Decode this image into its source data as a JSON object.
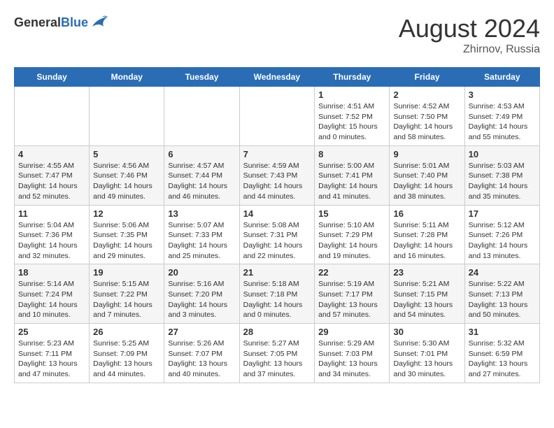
{
  "header": {
    "logo_general": "General",
    "logo_blue": "Blue",
    "month_year": "August 2024",
    "location": "Zhirnov, Russia"
  },
  "days_of_week": [
    "Sunday",
    "Monday",
    "Tuesday",
    "Wednesday",
    "Thursday",
    "Friday",
    "Saturday"
  ],
  "weeks": [
    [
      {
        "num": "",
        "info": ""
      },
      {
        "num": "",
        "info": ""
      },
      {
        "num": "",
        "info": ""
      },
      {
        "num": "",
        "info": ""
      },
      {
        "num": "1",
        "info": "Sunrise: 4:51 AM\nSunset: 7:52 PM\nDaylight: 15 hours\nand 0 minutes."
      },
      {
        "num": "2",
        "info": "Sunrise: 4:52 AM\nSunset: 7:50 PM\nDaylight: 14 hours\nand 58 minutes."
      },
      {
        "num": "3",
        "info": "Sunrise: 4:53 AM\nSunset: 7:49 PM\nDaylight: 14 hours\nand 55 minutes."
      }
    ],
    [
      {
        "num": "4",
        "info": "Sunrise: 4:55 AM\nSunset: 7:47 PM\nDaylight: 14 hours\nand 52 minutes."
      },
      {
        "num": "5",
        "info": "Sunrise: 4:56 AM\nSunset: 7:46 PM\nDaylight: 14 hours\nand 49 minutes."
      },
      {
        "num": "6",
        "info": "Sunrise: 4:57 AM\nSunset: 7:44 PM\nDaylight: 14 hours\nand 46 minutes."
      },
      {
        "num": "7",
        "info": "Sunrise: 4:59 AM\nSunset: 7:43 PM\nDaylight: 14 hours\nand 44 minutes."
      },
      {
        "num": "8",
        "info": "Sunrise: 5:00 AM\nSunset: 7:41 PM\nDaylight: 14 hours\nand 41 minutes."
      },
      {
        "num": "9",
        "info": "Sunrise: 5:01 AM\nSunset: 7:40 PM\nDaylight: 14 hours\nand 38 minutes."
      },
      {
        "num": "10",
        "info": "Sunrise: 5:03 AM\nSunset: 7:38 PM\nDaylight: 14 hours\nand 35 minutes."
      }
    ],
    [
      {
        "num": "11",
        "info": "Sunrise: 5:04 AM\nSunset: 7:36 PM\nDaylight: 14 hours\nand 32 minutes."
      },
      {
        "num": "12",
        "info": "Sunrise: 5:06 AM\nSunset: 7:35 PM\nDaylight: 14 hours\nand 29 minutes."
      },
      {
        "num": "13",
        "info": "Sunrise: 5:07 AM\nSunset: 7:33 PM\nDaylight: 14 hours\nand 25 minutes."
      },
      {
        "num": "14",
        "info": "Sunrise: 5:08 AM\nSunset: 7:31 PM\nDaylight: 14 hours\nand 22 minutes."
      },
      {
        "num": "15",
        "info": "Sunrise: 5:10 AM\nSunset: 7:29 PM\nDaylight: 14 hours\nand 19 minutes."
      },
      {
        "num": "16",
        "info": "Sunrise: 5:11 AM\nSunset: 7:28 PM\nDaylight: 14 hours\nand 16 minutes."
      },
      {
        "num": "17",
        "info": "Sunrise: 5:12 AM\nSunset: 7:26 PM\nDaylight: 14 hours\nand 13 minutes."
      }
    ],
    [
      {
        "num": "18",
        "info": "Sunrise: 5:14 AM\nSunset: 7:24 PM\nDaylight: 14 hours\nand 10 minutes."
      },
      {
        "num": "19",
        "info": "Sunrise: 5:15 AM\nSunset: 7:22 PM\nDaylight: 14 hours\nand 7 minutes."
      },
      {
        "num": "20",
        "info": "Sunrise: 5:16 AM\nSunset: 7:20 PM\nDaylight: 14 hours\nand 3 minutes."
      },
      {
        "num": "21",
        "info": "Sunrise: 5:18 AM\nSunset: 7:18 PM\nDaylight: 14 hours\nand 0 minutes."
      },
      {
        "num": "22",
        "info": "Sunrise: 5:19 AM\nSunset: 7:17 PM\nDaylight: 13 hours\nand 57 minutes."
      },
      {
        "num": "23",
        "info": "Sunrise: 5:21 AM\nSunset: 7:15 PM\nDaylight: 13 hours\nand 54 minutes."
      },
      {
        "num": "24",
        "info": "Sunrise: 5:22 AM\nSunset: 7:13 PM\nDaylight: 13 hours\nand 50 minutes."
      }
    ],
    [
      {
        "num": "25",
        "info": "Sunrise: 5:23 AM\nSunset: 7:11 PM\nDaylight: 13 hours\nand 47 minutes."
      },
      {
        "num": "26",
        "info": "Sunrise: 5:25 AM\nSunset: 7:09 PM\nDaylight: 13 hours\nand 44 minutes."
      },
      {
        "num": "27",
        "info": "Sunrise: 5:26 AM\nSunset: 7:07 PM\nDaylight: 13 hours\nand 40 minutes."
      },
      {
        "num": "28",
        "info": "Sunrise: 5:27 AM\nSunset: 7:05 PM\nDaylight: 13 hours\nand 37 minutes."
      },
      {
        "num": "29",
        "info": "Sunrise: 5:29 AM\nSunset: 7:03 PM\nDaylight: 13 hours\nand 34 minutes."
      },
      {
        "num": "30",
        "info": "Sunrise: 5:30 AM\nSunset: 7:01 PM\nDaylight: 13 hours\nand 30 minutes."
      },
      {
        "num": "31",
        "info": "Sunrise: 5:32 AM\nSunset: 6:59 PM\nDaylight: 13 hours\nand 27 minutes."
      }
    ]
  ]
}
